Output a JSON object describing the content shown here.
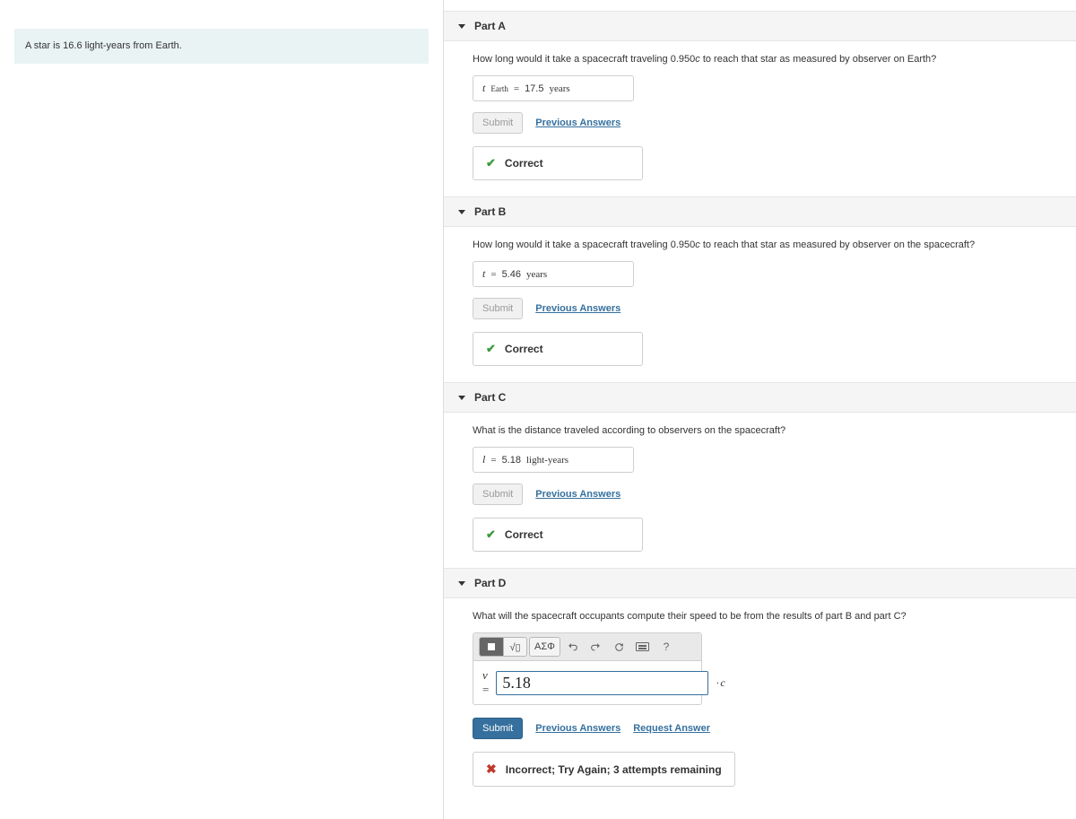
{
  "left": {
    "intro": "A star is 16.6 light-years from Earth."
  },
  "parts": {
    "a": {
      "title": "Part A",
      "prompt_prefix": "How long would it take a spacecraft traveling 0.950",
      "prompt_c": "c",
      "prompt_suffix": " to reach that star as measured by observer on Earth?",
      "var": "t",
      "sub": "Earth",
      "eq": "=",
      "value": "17.5",
      "unit": "years",
      "submit": "Submit",
      "prev": "Previous Answers",
      "feedback": "Correct"
    },
    "b": {
      "title": "Part B",
      "prompt_prefix": "How long would it take a spacecraft traveling 0.950",
      "prompt_c": "c",
      "prompt_suffix": " to reach that star as measured by observer on the spacecraft?",
      "var": "t",
      "eq": "=",
      "value": "5.46",
      "unit": "years",
      "submit": "Submit",
      "prev": "Previous Answers",
      "feedback": "Correct"
    },
    "c": {
      "title": "Part C",
      "prompt": "What is the distance traveled according to observers on the spacecraft?",
      "var": "l",
      "eq": "=",
      "value": "5.18",
      "unit": "light-years",
      "submit": "Submit",
      "prev": "Previous Answers",
      "feedback": "Correct"
    },
    "d": {
      "title": "Part D",
      "prompt": "What will the spacecraft occupants compute their speed to be from the results of part B and part C?",
      "var": "v",
      "eq": "=",
      "value": "5.18",
      "unit": "c",
      "submit": "Submit",
      "prev": "Previous Answers",
      "request": "Request Answer",
      "feedback": "Incorrect; Try Again; 3 attempts remaining",
      "tools": {
        "templates_sqrt": "√▯",
        "greek": "ΑΣΦ",
        "help": "?"
      }
    }
  }
}
